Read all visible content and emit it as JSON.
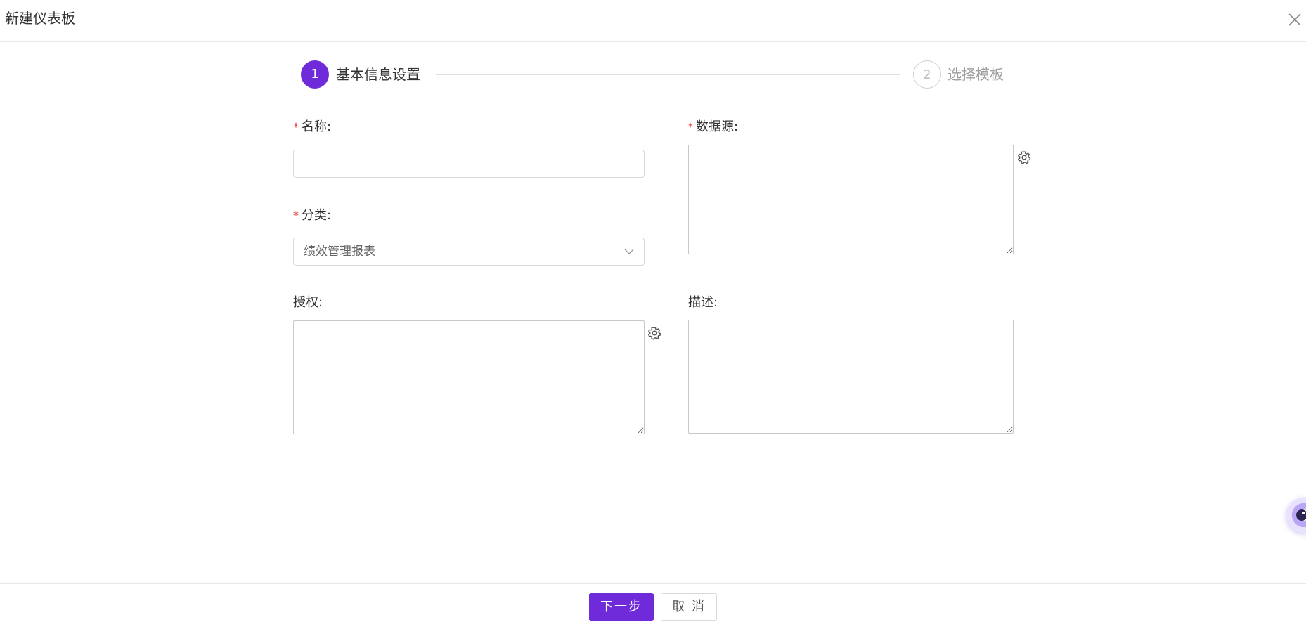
{
  "dialog": {
    "title": "新建仪表板"
  },
  "steps": [
    {
      "number": "1",
      "label": "基本信息设置",
      "state": "active"
    },
    {
      "number": "2",
      "label": "选择模板",
      "state": "pending"
    }
  ],
  "form": {
    "name": {
      "label": "名称:",
      "required": "*",
      "value": ""
    },
    "category": {
      "label": "分类:",
      "required": "*",
      "value": "绩效管理报表"
    },
    "datasource": {
      "label": "数据源:",
      "required": "*",
      "value": ""
    },
    "authorization": {
      "label": "授权:",
      "value": ""
    },
    "description": {
      "label": "描述:",
      "value": ""
    }
  },
  "footer": {
    "next_label": "下一步",
    "cancel_label": "取 消"
  },
  "colors": {
    "primary": "#6f2bd9",
    "required": "#e0413d"
  }
}
